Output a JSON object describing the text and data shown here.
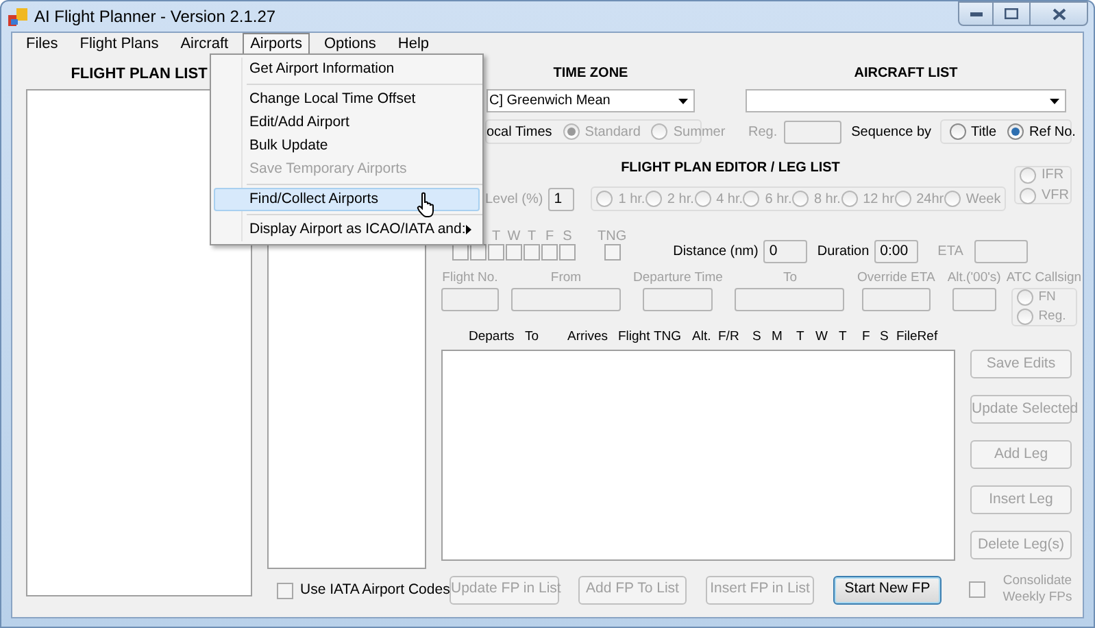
{
  "window": {
    "title": "AI Flight Planner - Version 2.1.27"
  },
  "menu_bar": [
    {
      "label": "Files",
      "selected": false
    },
    {
      "label": "Flight Plans",
      "selected": false
    },
    {
      "label": "Aircraft",
      "selected": false
    },
    {
      "label": "Airports",
      "selected": true
    },
    {
      "label": "Options",
      "selected": false
    },
    {
      "label": "Help",
      "selected": false
    }
  ],
  "airports_menu": [
    {
      "kind": "item",
      "label": "Get Airport Information",
      "disabled": false,
      "selected": false,
      "submenu": false
    },
    {
      "kind": "separator"
    },
    {
      "kind": "item",
      "label": "Change Local Time Offset",
      "disabled": false,
      "selected": false,
      "submenu": false
    },
    {
      "kind": "item",
      "label": "Edit/Add Airport",
      "disabled": false,
      "selected": false,
      "submenu": false
    },
    {
      "kind": "item",
      "label": "Bulk Update",
      "disabled": false,
      "selected": false,
      "submenu": false
    },
    {
      "kind": "item",
      "label": "Save Temporary Airports",
      "disabled": true,
      "selected": false,
      "submenu": false
    },
    {
      "kind": "separator"
    },
    {
      "kind": "item",
      "label": "Find/Collect Airports",
      "disabled": false,
      "selected": true,
      "submenu": false
    },
    {
      "kind": "separator"
    },
    {
      "kind": "item",
      "label": "Display Airport as ICAO/IATA and:",
      "disabled": false,
      "selected": false,
      "submenu": true
    }
  ],
  "flight_plan_list": {
    "title": "FLIGHT PLAN LIST"
  },
  "use_iata": {
    "label": "Use IATA Airport Codes",
    "checked": false
  },
  "time_zone": {
    "title": "TIME ZONE",
    "value": "C] Greenwich Mean",
    "local_times_label": "ocal Times",
    "options": [
      {
        "label": "Standard",
        "selected": true,
        "disabled": true
      },
      {
        "label": "Summer",
        "selected": false,
        "disabled": true
      }
    ]
  },
  "aircraft_list": {
    "title": "AIRCRAFT LIST",
    "reg_label": "Reg.",
    "sequence_label": "Sequence by",
    "sequence_options": [
      {
        "label": "Title",
        "selected": false,
        "disabled": false
      },
      {
        "label": "Ref No.",
        "selected": true,
        "disabled": false
      }
    ]
  },
  "editor": {
    "title": "FLIGHT PLAN EDITOR / LEG LIST",
    "level_label": "Level (%)",
    "level_value": "1",
    "intervals": [
      {
        "label": "1 hr.",
        "selected": false,
        "disabled": true
      },
      {
        "label": "2 hr.",
        "selected": false,
        "disabled": true
      },
      {
        "label": "4 hr.",
        "selected": false,
        "disabled": true
      },
      {
        "label": "6 hr.",
        "selected": false,
        "disabled": true
      },
      {
        "label": "8 hr.",
        "selected": false,
        "disabled": true
      },
      {
        "label": "12 hr",
        "selected": false,
        "disabled": true
      },
      {
        "label": "24hr",
        "selected": false,
        "disabled": true
      },
      {
        "label": "Week",
        "selected": false,
        "disabled": true
      }
    ],
    "flight_rules": [
      {
        "label": "IFR",
        "selected": false,
        "disabled": true
      },
      {
        "label": "VFR",
        "selected": false,
        "disabled": true
      }
    ],
    "days": [
      {
        "checked": false
      },
      {
        "checked": false
      },
      {
        "label": "T",
        "checked": false
      },
      {
        "label": "W",
        "checked": false
      },
      {
        "label": "T",
        "checked": false
      },
      {
        "label": "F",
        "checked": false
      },
      {
        "label": "S",
        "checked": false
      }
    ],
    "tng": {
      "label": "TNG",
      "checked": false
    },
    "distance_label": "Distance (nm)",
    "distance_value": "0",
    "duration_label": "Duration",
    "duration_value": "0:00",
    "eta_label": "ETA",
    "fields": [
      {
        "label": "Flight No."
      },
      {
        "label": "From"
      },
      {
        "label": "Departure Time"
      },
      {
        "label": "To"
      },
      {
        "label": "Override ETA"
      },
      {
        "label": "Alt.('00's)"
      }
    ],
    "atc_label": "ATC Callsign",
    "atc_options": [
      {
        "label": "FN",
        "selected": false,
        "disabled": true
      },
      {
        "label": "Reg.",
        "selected": false,
        "disabled": true
      }
    ],
    "columns": [
      "Departs",
      "To",
      "Arrives",
      "Flight",
      "TNG",
      "Alt.",
      "F/R",
      "S",
      "M",
      "T",
      "W",
      "T",
      "F",
      "S",
      "FileRef"
    ],
    "side_buttons": [
      {
        "label": "Save Edits",
        "disabled": true
      },
      {
        "label": "Update Selected",
        "disabled": true
      },
      {
        "label": "Add Leg",
        "disabled": true
      },
      {
        "label": "Insert Leg",
        "disabled": true
      },
      {
        "label": "Delete Leg(s)",
        "disabled": true
      }
    ],
    "bottom_buttons": [
      {
        "label": "Update FP in List",
        "disabled": true
      },
      {
        "label": "Add FP To List",
        "disabled": true
      },
      {
        "label": "Insert FP in List",
        "disabled": true
      },
      {
        "label": "Start New FP",
        "disabled": false
      }
    ],
    "consolidate": {
      "label": "Consolidate Weekly FPs",
      "checked": false
    }
  }
}
